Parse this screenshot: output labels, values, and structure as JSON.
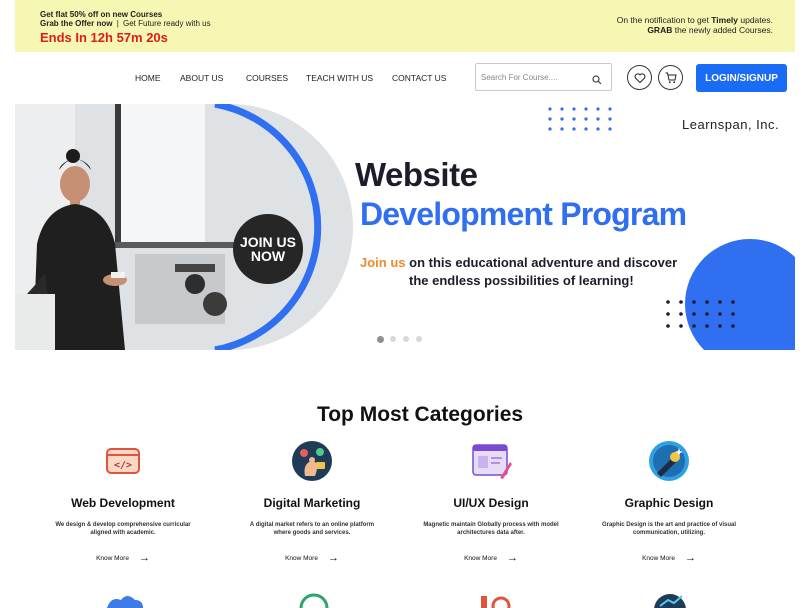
{
  "promo": {
    "line1": "Get flat 50% off on new Courses",
    "line2_bold": "Grab the Offer now",
    "line2_sep": "|",
    "line2_rest": "Get Future ready with us",
    "countdown": "Ends In 12h 57m 20s",
    "right1_pre": "On the notification to get ",
    "right1_bold": "Timely",
    "right1_post": " updates.",
    "right2_bold": "GRAB",
    "right2_rest": " the newly added Courses."
  },
  "nav": {
    "items": [
      "HOME",
      "ABOUT US",
      "COURSES",
      "TEACH WITH US",
      "CONTACT US"
    ],
    "search_placeholder": "Search For Course....",
    "login_label": "LOGIN/SIGNUP"
  },
  "hero": {
    "brand": "Learnspan, Inc.",
    "title1": "Website",
    "title2": "Development Program",
    "sub1_highlight": "Join us",
    "sub1_rest": " on this educational adventure and discover",
    "sub2": "the endless possibilities of learning!",
    "badge_line1": "JOIN US",
    "badge_line2": "NOW",
    "slide_count": 4,
    "active_slide": 1
  },
  "categories": {
    "title": "Top Most Categories",
    "know_more": "Know More",
    "arrow": "→",
    "items": [
      {
        "name": "Web Development",
        "desc": "We design & develop comprehensive curricular aligned with academic.",
        "icon": "code-window-icon"
      },
      {
        "name": "Digital Marketing",
        "desc": "A digital market refers to an online platform where goods and services.",
        "icon": "marketing-hand-icon"
      },
      {
        "name": "UI/UX Design",
        "desc": "Magnetic maintain Globally process with model architectures data after.",
        "icon": "design-brush-icon"
      },
      {
        "name": "Graphic Design",
        "desc": "Graphic Design is the art and practice of visual communication, utilizing.",
        "icon": "pen-tool-icon"
      }
    ]
  },
  "colors": {
    "accent": "#1a6cf5",
    "promo_bg": "#f6f7b2",
    "countdown": "#e01b1b",
    "highlight": "#f08a2c"
  }
}
